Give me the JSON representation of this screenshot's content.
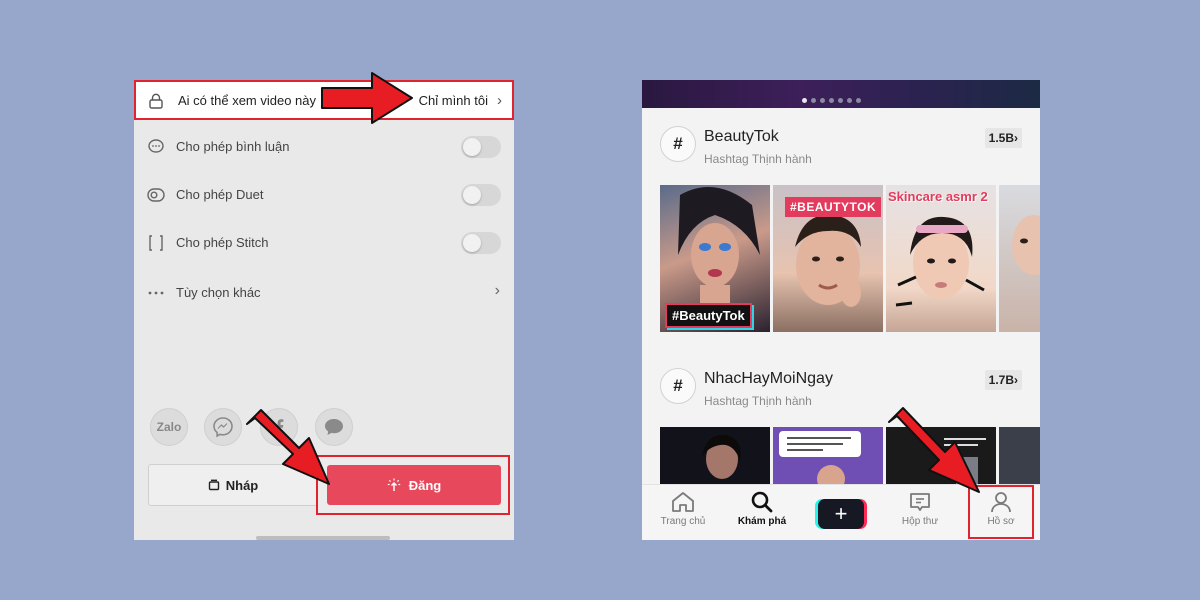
{
  "left_panel": {
    "privacy": {
      "question": "Ai có thể xem video này",
      "value": "Chỉ mình tôi"
    },
    "options": [
      {
        "label": "Cho phép bình luận",
        "icon": "comment-icon",
        "control": "toggle",
        "enabled": false
      },
      {
        "label": "Cho phép Duet",
        "icon": "duet-icon",
        "control": "toggle",
        "enabled": false
      },
      {
        "label": "Cho phép Stitch",
        "icon": "stitch-icon",
        "control": "toggle",
        "enabled": false
      },
      {
        "label": "Tùy chọn khác",
        "icon": "more-dots-icon",
        "control": "chevron"
      }
    ],
    "share_targets": [
      "Zalo",
      "messenger-icon",
      "facebook-icon",
      "messages-icon"
    ],
    "draft_label": "Nháp",
    "post_label": "Đăng"
  },
  "right_panel": {
    "hashtags": [
      {
        "name": "BeautyTok",
        "subtitle": "Hashtag Thịnh hành",
        "count": "1.5B"
      },
      {
        "name": "NhacHayMoiNgay",
        "subtitle": "Hashtag Thịnh hành",
        "count": "1.7B"
      }
    ],
    "thumb_captions": {
      "beautytok": "#BeautyTok",
      "hashtag_beautytok": "#BEAUTYTOK",
      "skincare": "Skincare asmr 2"
    },
    "tabs": [
      {
        "label": "Trang chủ",
        "icon": "home-icon"
      },
      {
        "label": "Khám phá",
        "icon": "search-icon",
        "active": true
      },
      {
        "label": "",
        "icon": "plus-icon"
      },
      {
        "label": "Hộp thư",
        "icon": "inbox-icon"
      },
      {
        "label": "Hồ sơ",
        "icon": "profile-icon"
      }
    ]
  },
  "colors": {
    "background": "#97a7cc",
    "highlight_red": "#e0242f",
    "post_button": "#e8485c"
  }
}
